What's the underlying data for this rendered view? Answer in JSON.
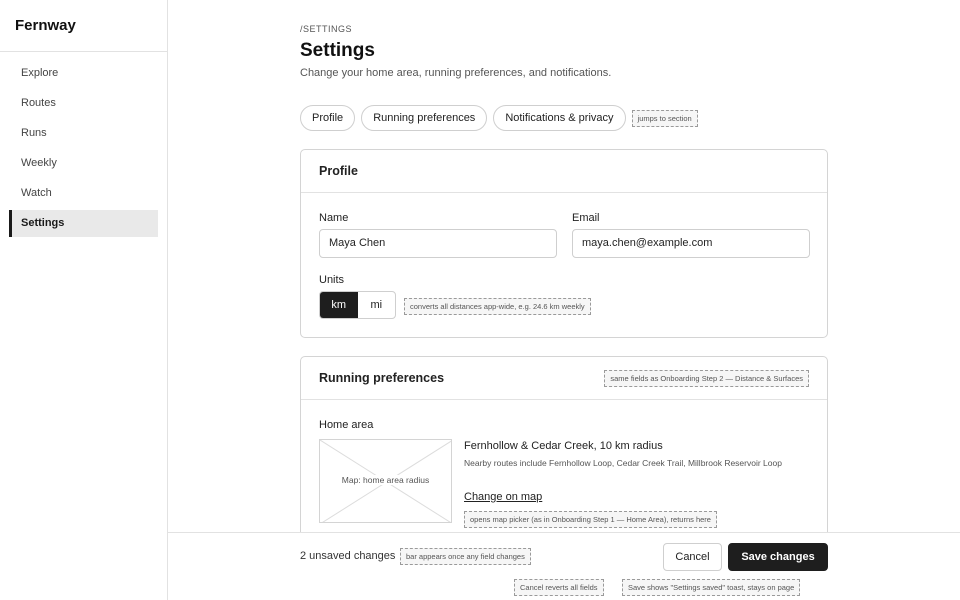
{
  "app": {
    "name": "Fernway"
  },
  "sidebar": {
    "items": [
      {
        "label": "Explore"
      },
      {
        "label": "Routes"
      },
      {
        "label": "Runs"
      },
      {
        "label": "Weekly"
      },
      {
        "label": "Watch"
      },
      {
        "label": "Settings",
        "active": true
      }
    ]
  },
  "header": {
    "breadcrumb": "/SETTINGS",
    "title": "Settings",
    "subtitle": "Change your home area, running preferences, and notifications."
  },
  "tabs": {
    "items": [
      {
        "label": "Profile"
      },
      {
        "label": "Running preferences"
      },
      {
        "label": "Notifications & privacy"
      }
    ],
    "note": "jumps to section"
  },
  "profile": {
    "title": "Profile",
    "name_label": "Name",
    "name_value": "Maya Chen",
    "email_label": "Email",
    "email_value": "maya.chen@example.com",
    "units_label": "Units",
    "units_options": [
      "km",
      "mi"
    ],
    "units_selected": "km",
    "units_note": "converts all distances app-wide, e.g. 24.6 km weekly"
  },
  "running": {
    "title": "Running preferences",
    "note": "same fields as Onboarding Step 2 — Distance & Surfaces",
    "home_area_label": "Home area",
    "map_placeholder": "Map: home area radius",
    "area_name": "Fernhollow & Cedar Creek, 10 km radius",
    "nearby": "Nearby routes include Fernhollow Loop, Cedar Creek Trail, Millbrook Reservoir Loop",
    "change_link": "Change on map",
    "change_note": "opens map picker (as in Onboarding Step 1 — Home Area), returns here"
  },
  "footer": {
    "unsaved": "2 unsaved changes",
    "unsaved_note": "bar appears once any field changes",
    "cancel_label": "Cancel",
    "save_label": "Save changes",
    "cancel_note": "Cancel reverts all fields",
    "save_note": "Save shows \"Settings saved\" toast, stays on page"
  },
  "colors": {
    "accent": "#1e1e1e",
    "border": "#d4d4d4",
    "active_nav_bg": "#e9e9e9"
  }
}
